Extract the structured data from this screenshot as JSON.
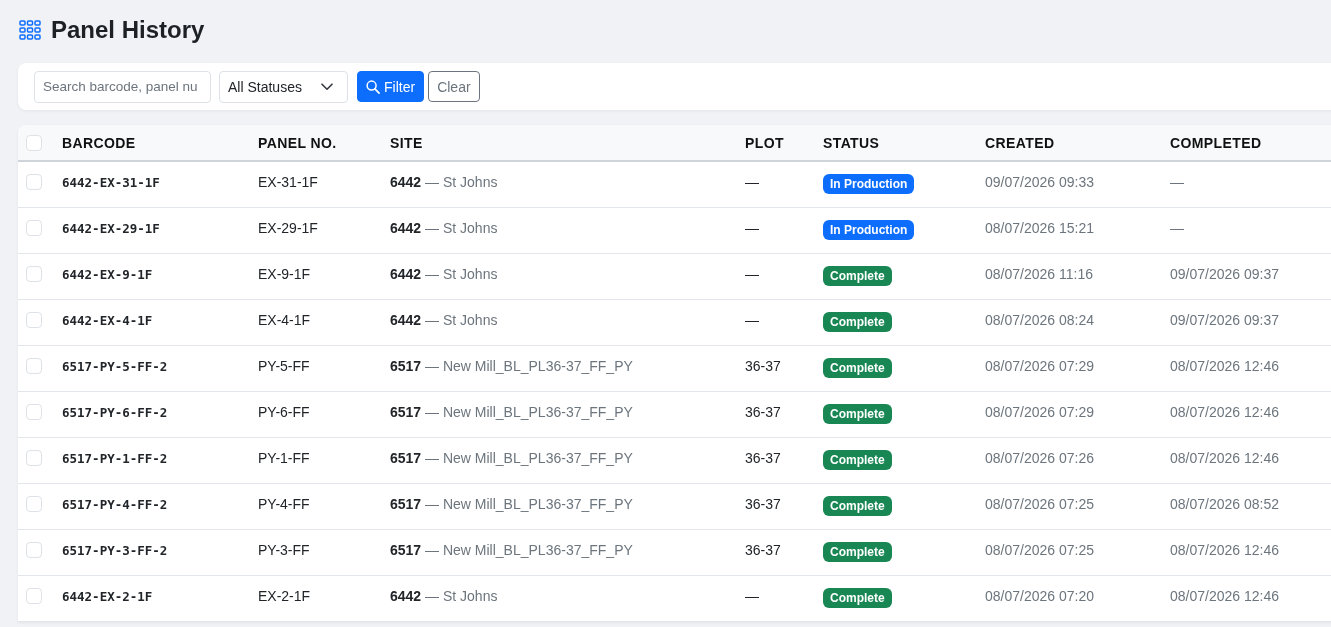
{
  "header": {
    "title": "Panel History"
  },
  "filters": {
    "search": {
      "placeholder": "Search barcode, panel nu"
    },
    "status_select": {
      "value": "All Statuses"
    },
    "buttons": [
      {
        "label": "Filter",
        "kind": "primary"
      },
      {
        "label": "Clear",
        "kind": "secondary"
      }
    ]
  },
  "table": {
    "select_all": {
      "checked": false
    },
    "columns": [
      "BARCODE",
      "PANEL NO.",
      "SITE",
      "PLOT",
      "STATUS",
      "CREATED",
      "COMPLETED"
    ],
    "rows": [
      {
        "checked": false,
        "barcode": "6442-EX-31-1F",
        "panel_no": "EX-31-1F",
        "site": "**6442** — St Johns",
        "plot": "—",
        "status": {
          "label": "In Production",
          "color": "#0d6efd"
        },
        "created": "09/07/2026 09:33",
        "completed": "—"
      },
      {
        "checked": false,
        "barcode": "6442-EX-29-1F",
        "panel_no": "EX-29-1F",
        "site": "**6442** — St Johns",
        "plot": "—",
        "status": {
          "label": "In Production",
          "color": "#0d6efd"
        },
        "created": "08/07/2026 15:21",
        "completed": "—"
      },
      {
        "checked": false,
        "barcode": "6442-EX-9-1F",
        "panel_no": "EX-9-1F",
        "site": "**6442** — St Johns",
        "plot": "—",
        "status": {
          "label": "Complete",
          "color": "#198754"
        },
        "created": "08/07/2026 11:16",
        "completed": "09/07/2026 09:37"
      },
      {
        "checked": false,
        "barcode": "6442-EX-4-1F",
        "panel_no": "EX-4-1F",
        "site": "**6442** — St Johns",
        "plot": "—",
        "status": {
          "label": "Complete",
          "color": "#198754"
        },
        "created": "08/07/2026 08:24",
        "completed": "09/07/2026 09:37"
      },
      {
        "checked": false,
        "barcode": "6517-PY-5-FF-2",
        "panel_no": "PY-5-FF",
        "site": "**6517** — New Mill_BL_PL36-37_FF_PY",
        "plot": "36-37",
        "status": {
          "label": "Complete",
          "color": "#198754"
        },
        "created": "08/07/2026 07:29",
        "completed": "08/07/2026 12:46"
      },
      {
        "checked": false,
        "barcode": "6517-PY-6-FF-2",
        "panel_no": "PY-6-FF",
        "site": "**6517** — New Mill_BL_PL36-37_FF_PY",
        "plot": "36-37",
        "status": {
          "label": "Complete",
          "color": "#198754"
        },
        "created": "08/07/2026 07:29",
        "completed": "08/07/2026 12:46"
      },
      {
        "checked": false,
        "barcode": "6517-PY-1-FF-2",
        "panel_no": "PY-1-FF",
        "site": "**6517** — New Mill_BL_PL36-37_FF_PY",
        "plot": "36-37",
        "status": {
          "label": "Complete",
          "color": "#198754"
        },
        "created": "08/07/2026 07:26",
        "completed": "08/07/2026 12:46"
      },
      {
        "checked": false,
        "barcode": "6517-PY-4-FF-2",
        "panel_no": "PY-4-FF",
        "site": "**6517** — New Mill_BL_PL36-37_FF_PY",
        "plot": "36-37",
        "status": {
          "label": "Complete",
          "color": "#198754"
        },
        "created": "08/07/2026 07:25",
        "completed": "08/07/2026 08:52"
      },
      {
        "checked": false,
        "barcode": "6517-PY-3-FF-2",
        "panel_no": "PY-3-FF",
        "site": "**6517** — New Mill_BL_PL36-37_FF_PY",
        "plot": "36-37",
        "status": {
          "label": "Complete",
          "color": "#198754"
        },
        "created": "08/07/2026 07:25",
        "completed": "08/07/2026 12:46"
      },
      {
        "checked": false,
        "barcode": "6442-EX-2-1F",
        "panel_no": "EX-2-1F",
        "site": "**6442** — St Johns",
        "plot": "—",
        "status": {
          "label": "Complete",
          "color": "#198754"
        },
        "created": "08/07/2026 07:20",
        "completed": "08/07/2026 12:46"
      }
    ]
  }
}
